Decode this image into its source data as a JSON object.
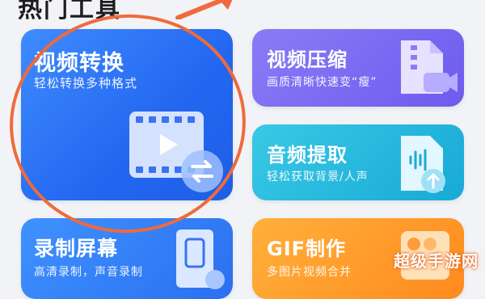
{
  "section": {
    "title": "热门工具"
  },
  "cards": {
    "convert": {
      "title": "视频转换",
      "subtitle": "轻松转换多种格式"
    },
    "compress": {
      "title": "视频压缩",
      "subtitle": "画质清晰快速变“瘦”"
    },
    "audio": {
      "title": "音频提取",
      "subtitle": "轻松获取背景/人声"
    },
    "record": {
      "title": "录制屏幕",
      "subtitle": "高清录制，声音录制"
    },
    "gif": {
      "title": "GIF制作",
      "subtitle": "多图片视频合并"
    }
  },
  "watermark": {
    "text": "超级手游网"
  },
  "colors": {
    "convert": "#2367f0",
    "compress": "#6d5bee",
    "audio": "#18a9d6",
    "record": "#2a6ff0",
    "gif": "#ff8a1e",
    "annotation_ring": "#f06a3c"
  }
}
